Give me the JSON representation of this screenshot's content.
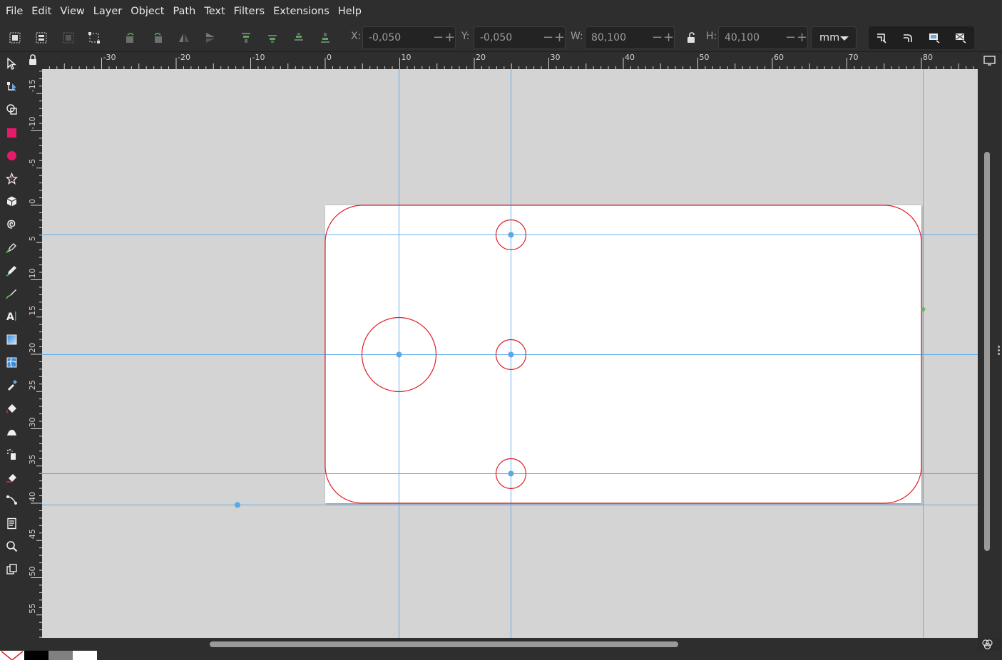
{
  "menu": [
    "File",
    "Edit",
    "View",
    "Layer",
    "Object",
    "Path",
    "Text",
    "Filters",
    "Extensions",
    "Help"
  ],
  "controls": {
    "x_label": "X:",
    "x_value": "-0,050",
    "y_label": "Y:",
    "y_value": "-0,050",
    "w_label": "W:",
    "w_value": "80,100",
    "h_label": "H:",
    "h_value": "40,100",
    "unit": "mm",
    "minus": "−",
    "plus": "+"
  },
  "ruler": {
    "h_labels": [
      "-30",
      "-20",
      "-10",
      "0",
      "10",
      "20",
      "30",
      "40",
      "50",
      "60",
      "70",
      "80"
    ],
    "v_labels": [
      "-15",
      "-10",
      "-5",
      "0",
      "5",
      "10",
      "15",
      "20",
      "25",
      "30",
      "35",
      "40",
      "45",
      "50",
      "55"
    ]
  },
  "tools": [
    "selector-icon",
    "node-icon",
    "shape-builder-icon",
    "rectangle-icon",
    "ellipse-icon",
    "star-icon",
    "3d-box-icon",
    "spiral-icon",
    "pen-icon",
    "pencil-icon",
    "calligraphy-icon",
    "text-icon",
    "gradient-icon",
    "mesh-icon",
    "dropper-icon",
    "paint-bucket-icon",
    "tweak-icon",
    "spray-icon",
    "eraser-icon",
    "connector-icon",
    "pages-icon",
    "zoom-icon",
    "clone-icon"
  ],
  "colors": {
    "accent_guides": "#5aa9e6",
    "outline": "#e0202a",
    "rect_tool": "#e6196b",
    "ellipse_tool": "#e6196b"
  },
  "palette": [
    "none",
    "#000000",
    "#808080",
    "#ffffff"
  ]
}
